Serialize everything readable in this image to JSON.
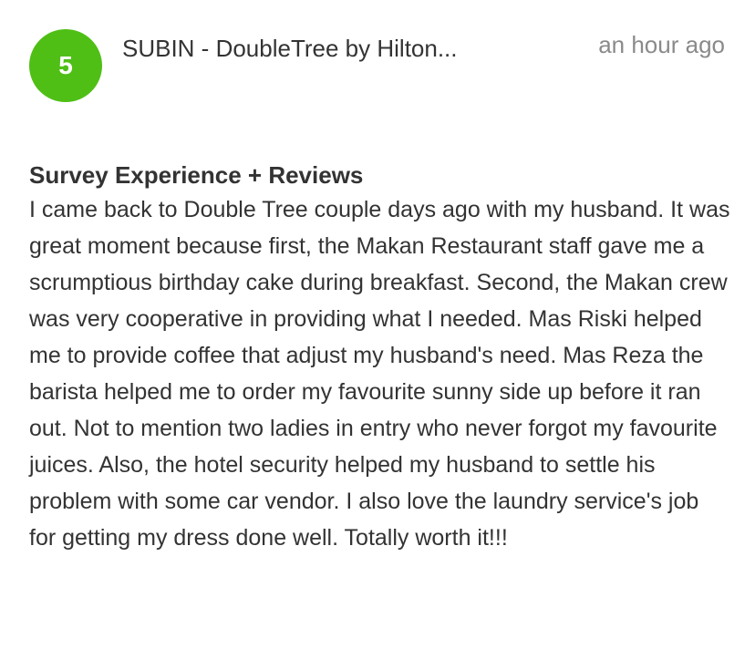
{
  "review": {
    "rating": "5",
    "rating_color": "#4fbf16",
    "source_title": "SUBIN - DoubleTree by Hilton...",
    "timestamp": "an hour ago",
    "heading": "Survey Experience + Reviews",
    "body": "I came back to Double Tree couple days ago with my husband. It was great moment because first, the Makan Restaurant staff gave me a scrumptious birthday cake during breakfast. Second, the Makan crew was very cooperative in providing what I needed. Mas Riski helped me to provide coffee that adjust my husband's need. Mas Reza the barista helped me to order my favourite sunny side up before it ran out. Not to mention two ladies in entry who never forgot my favourite juices. Also, the hotel security helped my husband to settle his problem with some car vendor. I also love the laundry service's job for getting my dress done well. Totally worth it!!!"
  }
}
